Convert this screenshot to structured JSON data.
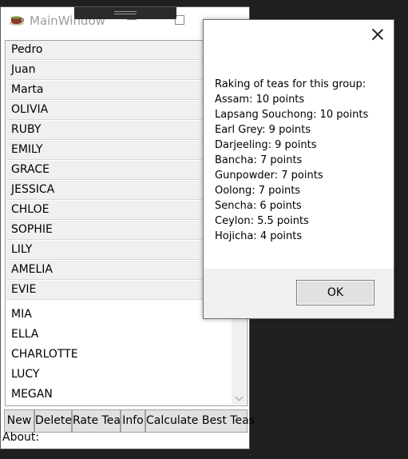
{
  "main_window": {
    "title": "MainWindow",
    "names": [
      "Pedro",
      "Juan",
      "Marta",
      "OLIVIA",
      "RUBY",
      "EMILY",
      "GRACE",
      "JESSICA",
      "CHLOE",
      "SOPHIE",
      "LILY",
      "AMELIA",
      "EVIE",
      "MIA",
      "ELLA",
      "CHARLOTTE",
      "LUCY",
      "MEGAN"
    ],
    "buttons": {
      "new": "New",
      "delete": "Delete",
      "rate_tea": "Rate Tea",
      "info": "Info",
      "calculate": "Calculate Best Teas"
    },
    "about_label": "About:"
  },
  "dialog": {
    "heading": "Raking of teas for this group:",
    "rankings": [
      "Assam: 10 points",
      "Lapsang Souchong: 10 points",
      "Earl Grey: 9 points",
      "Darjeeling: 9 points",
      "Bancha: 7 points",
      "Gunpowder: 7 points",
      "Oolong: 7 points",
      "Sencha: 6 points",
      "Ceylon: 5.5 points",
      "Hojicha: 4 points"
    ],
    "ok_label": "OK"
  },
  "colors": {
    "desktop": "#202020",
    "button_face": "#e1e1e1",
    "dialog_footer": "#f0f0f0"
  }
}
